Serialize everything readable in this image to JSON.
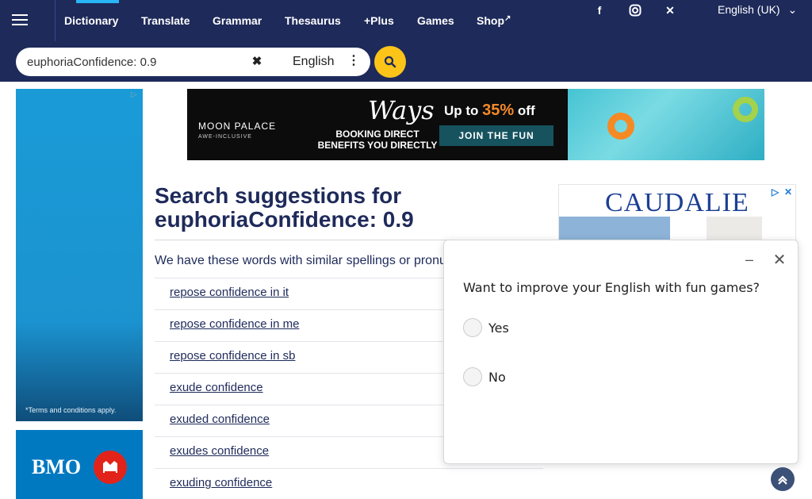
{
  "nav": {
    "items": [
      {
        "label": "Dictionary",
        "x_note": "active"
      },
      {
        "label": "Translate"
      },
      {
        "label": "Grammar"
      },
      {
        "label": "Thesaurus"
      },
      {
        "label": "+Plus"
      },
      {
        "label": "Games"
      },
      {
        "label": "Shop"
      }
    ],
    "language": "English (UK)"
  },
  "search": {
    "value": "euphoriaConfidence: 0.9",
    "dictionary": "English"
  },
  "main": {
    "heading_line1": "Search suggestions for",
    "heading_query": "euphoriaConfidence: 0.9",
    "intro": "We have these words with similar spellings or pronunciations:",
    "suggestions": [
      "repose confidence in it",
      "repose confidence in me",
      "repose confidence in sb",
      "exude confidence",
      "exuded confidence",
      "exudes confidence",
      "exuding confidence"
    ]
  },
  "banner_ad": {
    "brand": "MOON PALACE",
    "brand_sub": "AWE-INCLUSIVE",
    "script": "Ways",
    "tagline_1": "BOOKING DIRECT",
    "tagline_2": "BENEFITS YOU DIRECTLY",
    "offer_pre": "Up to ",
    "offer_pct": "35%",
    "offer_post": " off",
    "cta": "JOIN THE FUN"
  },
  "left_ad": {
    "terms": "*Terms and conditions apply.",
    "brand": "BMO"
  },
  "right_ad": {
    "brand": "CAUDALIE"
  },
  "popup": {
    "question": "Want to improve your English with fun games?",
    "options": [
      "Yes",
      "No"
    ]
  },
  "colors": {
    "nav_bg": "#1e2a5a",
    "search_button": "#fcc419",
    "link": "#1e2a5a"
  }
}
